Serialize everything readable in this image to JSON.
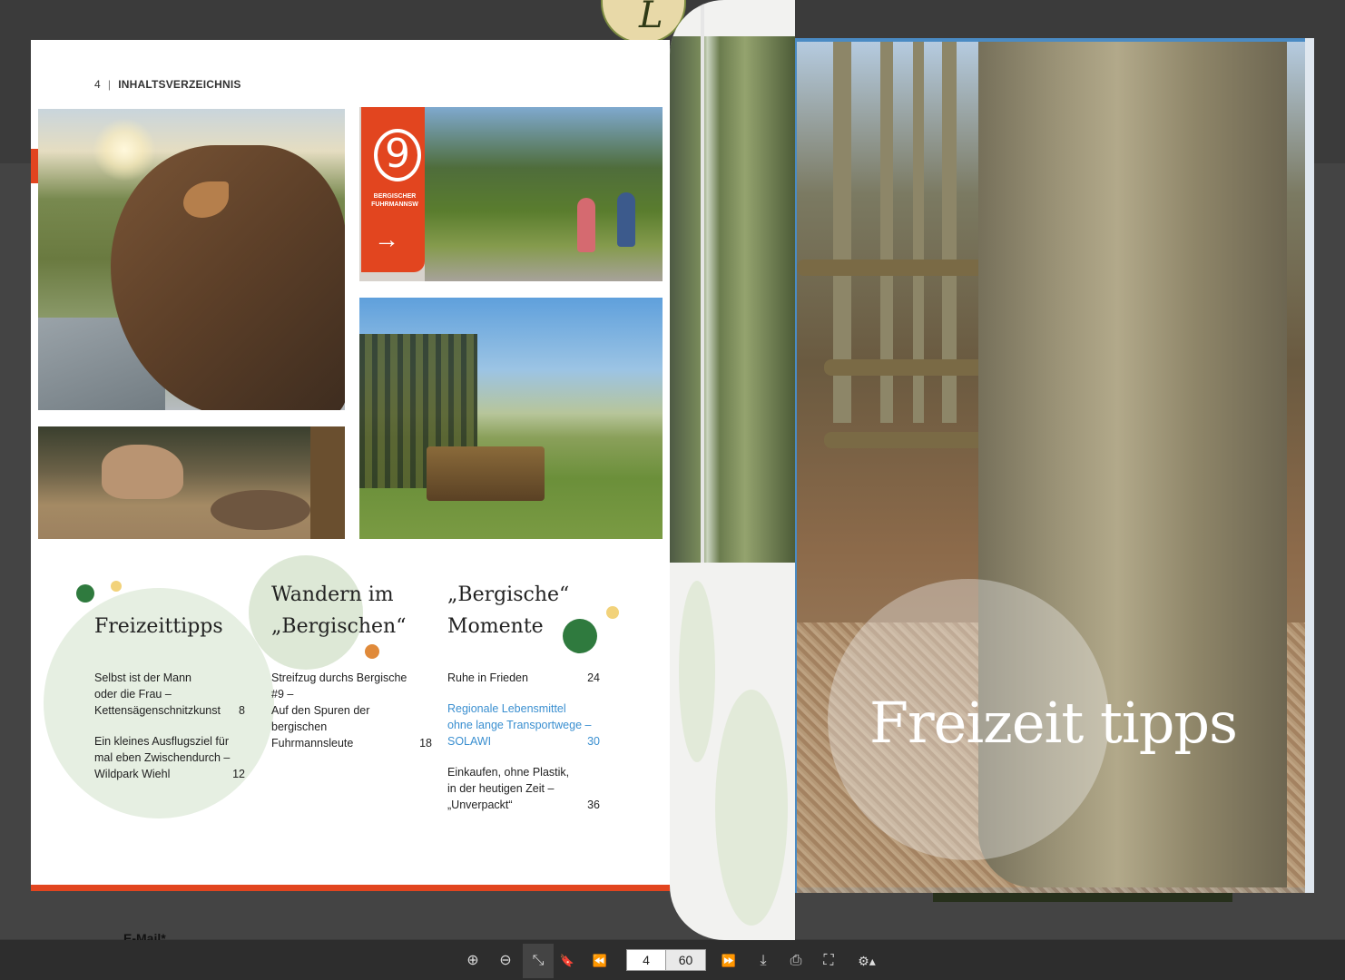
{
  "viewer": {
    "background_email_label": "E-Mail*",
    "emblem_letter": "L"
  },
  "left_page": {
    "page_number": "4",
    "separator": "|",
    "section_title": "INHALTSVERZEICHNIS",
    "sign_number": "9",
    "sign_text": "BERGISCHER FUHRMANNSW",
    "sign_arrow": "→",
    "toc": [
      {
        "title_lines": [
          "",
          "Freizeittipps"
        ],
        "entries": [
          {
            "lines": [
              "Selbst ist der Mann",
              "oder die Frau –",
              "Kettensägenschnitzkunst"
            ],
            "page": "8",
            "link": false
          },
          {
            "lines": [
              "Ein kleines Ausflugsziel für",
              "mal eben Zwischendurch –",
              "Wildpark Wiehl"
            ],
            "page": "12",
            "link": false
          }
        ]
      },
      {
        "title_lines": [
          "Wandern im",
          "„Bergischen“"
        ],
        "entries": [
          {
            "lines": [
              "Streifzug durchs Bergische #9 –",
              "Auf den Spuren der",
              "bergischen",
              "Fuhrmannsleute"
            ],
            "page": "18",
            "link": false
          }
        ]
      },
      {
        "title_lines": [
          "„Bergische“",
          "Momente"
        ],
        "entries": [
          {
            "lines": [
              "Ruhe in Frieden"
            ],
            "page": "24",
            "link": false
          },
          {
            "lines": [
              "Regionale Lebensmittel",
              "ohne lange Transportwege –",
              "SOLAWI"
            ],
            "page": "30",
            "link": true
          },
          {
            "lines": [
              "Einkaufen, ohne Plastik,",
              "in der heutigen Zeit  –",
              "„Unverpackt“"
            ],
            "page": "36",
            "link": false
          }
        ]
      }
    ]
  },
  "right_page": {
    "title": "Freizeit tipps"
  },
  "toolbar": {
    "zoom_in": "⊕",
    "zoom_out": "⊖",
    "fit": "⤡",
    "bookmark": "🔖",
    "prev": "⏪",
    "current_page": "4",
    "total_pages": "60",
    "next": "⏩",
    "download": "⤓",
    "print": "⎙",
    "fullscreen": "⛶",
    "settings": "⚙▴"
  },
  "colors": {
    "accent_red": "#e2451f",
    "accent_green": "#2f7a3e",
    "accent_yellow": "#f2d27a",
    "accent_orange": "#e08a3a",
    "link_blue": "#3a8fd0",
    "circle_green": "#e6efe2"
  }
}
